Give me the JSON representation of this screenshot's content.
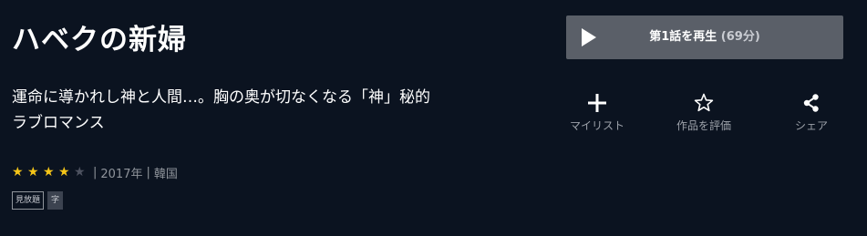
{
  "title": "ハベクの新婦",
  "description_line1": "運命に導かれし神と人間…。胸の奥が切なくなる「神」秘的",
  "description_line2": "ラブロマンス",
  "rating": {
    "filled": 4,
    "total": 5
  },
  "year": "2017年",
  "country": "韓国",
  "divider": "|",
  "badges": [
    "見放題",
    "字"
  ],
  "play_button": {
    "label": "第1話を再生",
    "duration": "(69分)"
  },
  "actions": {
    "mylist": "マイリスト",
    "rate": "作品を評価",
    "share": "シェア"
  },
  "colors": {
    "background": "#0b1320",
    "star_on": "#f5c518",
    "star_off": "#4d5260",
    "button": "#5a5f68"
  },
  "icons": {
    "play": "play-icon",
    "plus": "plus-icon",
    "star": "star-outline-icon",
    "share": "share-icon"
  }
}
